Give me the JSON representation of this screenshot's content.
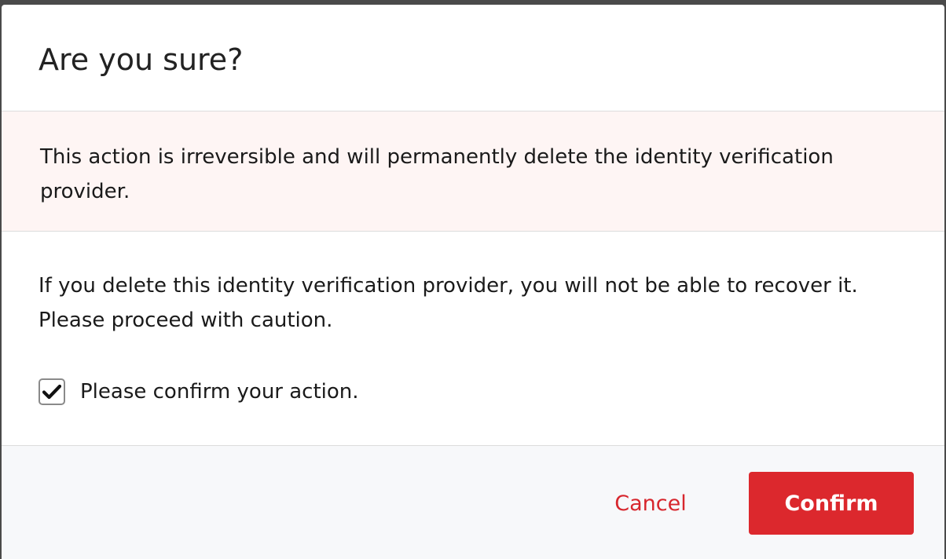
{
  "dialog": {
    "title": "Are you sure?",
    "warning": "This action is irreversible and will permanently delete the identity verification provider.",
    "message": "If you delete this identity verification provider, you will not be able to recover it. Please proceed with caution.",
    "confirm_checkbox": {
      "label": "Please confirm your action.",
      "checked": true,
      "icon": "checkmark-icon"
    },
    "buttons": {
      "cancel_label": "Cancel",
      "confirm_label": "Confirm"
    }
  },
  "colors": {
    "danger": "#dc282d",
    "cancel_text": "#d7262d",
    "alert_background": "#fef5f4",
    "footer_background": "#f7f8fa"
  }
}
